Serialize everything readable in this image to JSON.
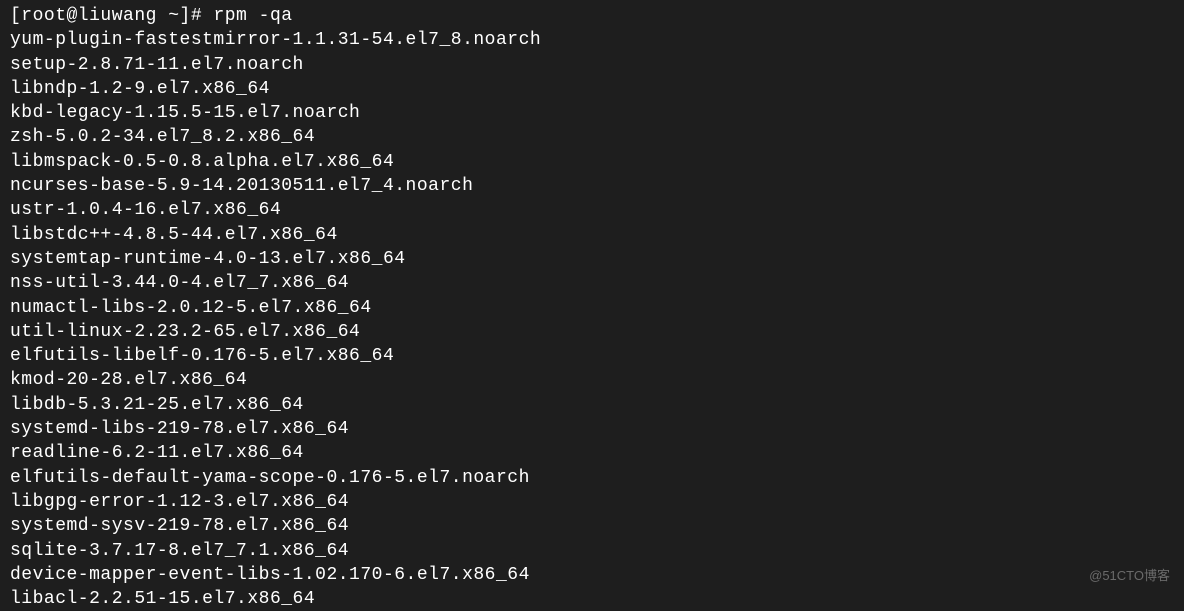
{
  "terminal": {
    "prompt": "[root@liuwang ~]# ",
    "command": "rpm -qa",
    "output_lines": [
      "yum-plugin-fastestmirror-1.1.31-54.el7_8.noarch",
      "setup-2.8.71-11.el7.noarch",
      "libndp-1.2-9.el7.x86_64",
      "kbd-legacy-1.15.5-15.el7.noarch",
      "zsh-5.0.2-34.el7_8.2.x86_64",
      "libmspack-0.5-0.8.alpha.el7.x86_64",
      "ncurses-base-5.9-14.20130511.el7_4.noarch",
      "ustr-1.0.4-16.el7.x86_64",
      "libstdc++-4.8.5-44.el7.x86_64",
      "systemtap-runtime-4.0-13.el7.x86_64",
      "nss-util-3.44.0-4.el7_7.x86_64",
      "numactl-libs-2.0.12-5.el7.x86_64",
      "util-linux-2.23.2-65.el7.x86_64",
      "elfutils-libelf-0.176-5.el7.x86_64",
      "kmod-20-28.el7.x86_64",
      "libdb-5.3.21-25.el7.x86_64",
      "systemd-libs-219-78.el7.x86_64",
      "readline-6.2-11.el7.x86_64",
      "elfutils-default-yama-scope-0.176-5.el7.noarch",
      "libgpg-error-1.12-3.el7.x86_64",
      "systemd-sysv-219-78.el7.x86_64",
      "sqlite-3.7.17-8.el7_7.1.x86_64",
      "device-mapper-event-libs-1.02.170-6.el7.x86_64",
      "libacl-2.2.51-15.el7.x86_64"
    ]
  },
  "watermark": "@51CTO博客"
}
